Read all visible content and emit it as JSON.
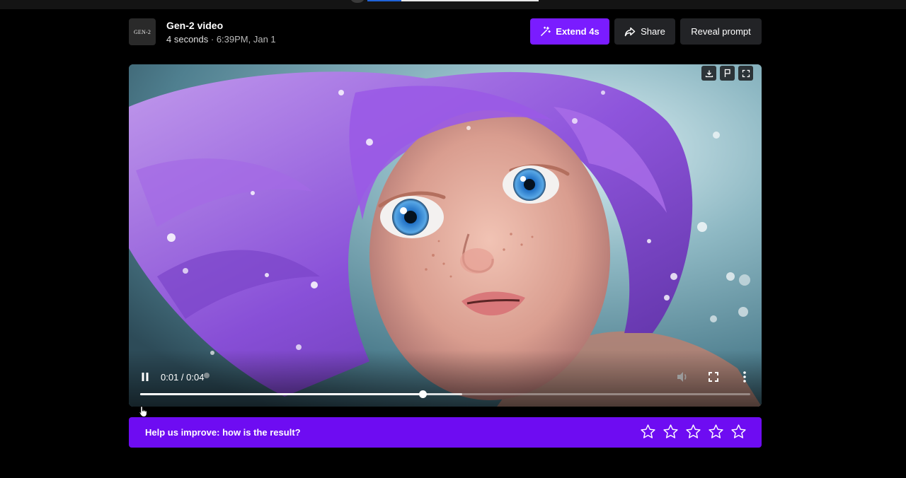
{
  "top_bar": {
    "progress": 0.2
  },
  "header": {
    "logo_text": "GEN-2",
    "title": "Gen-2 video",
    "duration": "4 seconds",
    "timestamp": "6:39PM, Jan 1",
    "separator": " · "
  },
  "actions": {
    "extend_label": "Extend 4s",
    "share_label": "Share",
    "reveal_label": "Reveal prompt",
    "extend_icon": "magic-wand-icon",
    "share_icon": "share-arrow-icon"
  },
  "player": {
    "overlay_icons": [
      "download-icon",
      "flag-icon",
      "expand-icon"
    ],
    "current_time": "0:01",
    "duration": "0:04",
    "time_separator": " / ",
    "played_fraction": 0.463,
    "buffered_fraction": 0.528,
    "state": "playing"
  },
  "feedback": {
    "prompt": "Help us improve: how is the result?",
    "stars_total": 5,
    "rating": 0
  },
  "colors": {
    "accent": "#7a1cff",
    "feedback_bg": "#6e0cf2",
    "button_bg": "#222326",
    "page_bg": "#000000"
  }
}
